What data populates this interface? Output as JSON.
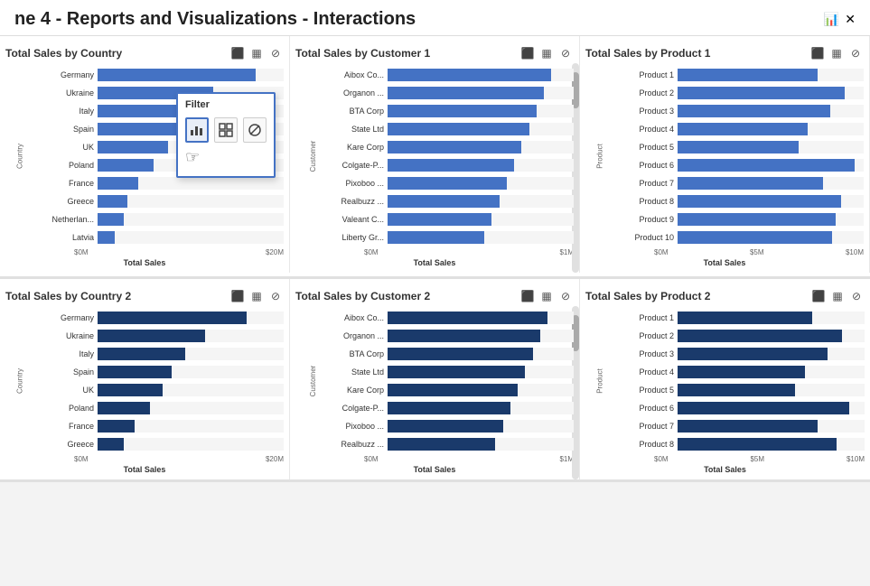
{
  "header": {
    "title": "ne 4 - Reports and Visualizations - Interactions"
  },
  "filterPopup": {
    "title": "Filter",
    "icons": [
      "bar_chart",
      "table_chart",
      "block"
    ]
  },
  "row1": {
    "charts": [
      {
        "id": "country1",
        "title": "Total Sales by Country",
        "axisX": "Total Sales",
        "axisY": "Country",
        "axisLabels": [
          "$0M",
          "$20M"
        ],
        "bars": [
          {
            "label": "Germany",
            "pct": 85,
            "dark": false
          },
          {
            "label": "Ukraine",
            "pct": 62,
            "dark": false
          },
          {
            "label": "Italy",
            "pct": 50,
            "dark": false
          },
          {
            "label": "Spain",
            "pct": 42,
            "dark": false
          },
          {
            "label": "UK",
            "pct": 38,
            "dark": false
          },
          {
            "label": "Poland",
            "pct": 30,
            "dark": false
          },
          {
            "label": "France",
            "pct": 22,
            "dark": false
          },
          {
            "label": "Greece",
            "pct": 16,
            "dark": false
          },
          {
            "label": "Netherlan...",
            "pct": 14,
            "dark": false
          },
          {
            "label": "Latvia",
            "pct": 9,
            "dark": false
          }
        ]
      },
      {
        "id": "customer1",
        "title": "Total Sales by Customer 1",
        "axisX": "Total Sales",
        "axisY": "Customer",
        "axisLabels": [
          "$0M",
          "$1M"
        ],
        "bars": [
          {
            "label": "Aibox Co...",
            "pct": 88,
            "dark": false
          },
          {
            "label": "Organon ...",
            "pct": 84,
            "dark": false
          },
          {
            "label": "BTA Corp",
            "pct": 80,
            "dark": false
          },
          {
            "label": "State Ltd",
            "pct": 76,
            "dark": false
          },
          {
            "label": "Kare Corp",
            "pct": 72,
            "dark": false
          },
          {
            "label": "Colgate-P...",
            "pct": 68,
            "dark": false
          },
          {
            "label": "Pixoboo ...",
            "pct": 64,
            "dark": false
          },
          {
            "label": "Realbuzz ...",
            "pct": 60,
            "dark": false
          },
          {
            "label": "Valeant C...",
            "pct": 56,
            "dark": false
          },
          {
            "label": "Liberty Gr...",
            "pct": 52,
            "dark": false
          }
        ]
      },
      {
        "id": "product1",
        "title": "Total Sales by Product 1",
        "axisX": "Total Sales",
        "axisY": "Product",
        "axisLabels": [
          "$0M",
          "$5M",
          "$10M"
        ],
        "bars": [
          {
            "label": "Product 1",
            "pct": 75,
            "dark": false
          },
          {
            "label": "Product 2",
            "pct": 90,
            "dark": false
          },
          {
            "label": "Product 3",
            "pct": 82,
            "dark": false
          },
          {
            "label": "Product 4",
            "pct": 70,
            "dark": false
          },
          {
            "label": "Product 5",
            "pct": 65,
            "dark": false
          },
          {
            "label": "Product 6",
            "pct": 95,
            "dark": false
          },
          {
            "label": "Product 7",
            "pct": 78,
            "dark": false
          },
          {
            "label": "Product 8",
            "pct": 88,
            "dark": false
          },
          {
            "label": "Product 9",
            "pct": 85,
            "dark": false
          },
          {
            "label": "Product 10",
            "pct": 83,
            "dark": false
          }
        ]
      }
    ]
  },
  "row2": {
    "charts": [
      {
        "id": "country2",
        "title": "Total Sales by Country 2",
        "axisX": "Total Sales",
        "axisY": "Country",
        "axisLabels": [
          "$0M",
          "$20M"
        ],
        "bars": [
          {
            "label": "Germany",
            "pct": 80,
            "dark": true
          },
          {
            "label": "Ukraine",
            "pct": 58,
            "dark": true
          },
          {
            "label": "Italy",
            "pct": 47,
            "dark": true
          },
          {
            "label": "Spain",
            "pct": 40,
            "dark": true
          },
          {
            "label": "UK",
            "pct": 35,
            "dark": true
          },
          {
            "label": "Poland",
            "pct": 28,
            "dark": true
          },
          {
            "label": "France",
            "pct": 20,
            "dark": true
          },
          {
            "label": "Greece",
            "pct": 14,
            "dark": true
          }
        ]
      },
      {
        "id": "customer2",
        "title": "Total Sales by Customer 2",
        "axisX": "Total Sales",
        "axisY": "Customer",
        "axisLabels": [
          "$0M",
          "$1M"
        ],
        "bars": [
          {
            "label": "Aibox Co...",
            "pct": 86,
            "dark": true
          },
          {
            "label": "Organon ...",
            "pct": 82,
            "dark": true
          },
          {
            "label": "BTA Corp",
            "pct": 78,
            "dark": true
          },
          {
            "label": "State Ltd",
            "pct": 74,
            "dark": true
          },
          {
            "label": "Kare Corp",
            "pct": 70,
            "dark": true
          },
          {
            "label": "Colgate-P...",
            "pct": 66,
            "dark": true
          },
          {
            "label": "Pixoboo ...",
            "pct": 62,
            "dark": true
          },
          {
            "label": "Realbuzz ...",
            "pct": 58,
            "dark": true
          }
        ]
      },
      {
        "id": "product2",
        "title": "Total Sales by Product 2",
        "axisX": "Total Sales",
        "axisY": "Product",
        "axisLabels": [
          "$0M",
          "$5M",
          "$10M"
        ],
        "bars": [
          {
            "label": "Product 1",
            "pct": 72,
            "dark": true
          },
          {
            "label": "Product 2",
            "pct": 88,
            "dark": true
          },
          {
            "label": "Product 3",
            "pct": 80,
            "dark": true
          },
          {
            "label": "Product 4",
            "pct": 68,
            "dark": true
          },
          {
            "label": "Product 5",
            "pct": 63,
            "dark": true
          },
          {
            "label": "Product 6",
            "pct": 92,
            "dark": true
          },
          {
            "label": "Product 7",
            "pct": 75,
            "dark": true
          },
          {
            "label": "Product 8",
            "pct": 85,
            "dark": true
          }
        ]
      }
    ]
  },
  "icons": {
    "barChart": "📊",
    "tableChart": "⊞",
    "noFilter": "⊘"
  }
}
